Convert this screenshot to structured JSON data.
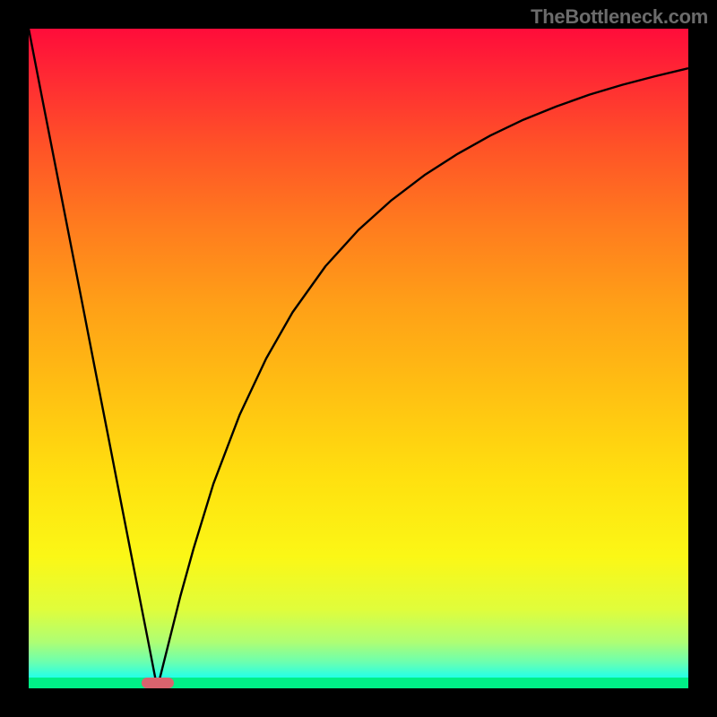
{
  "watermark": "TheBottleneck.com",
  "chart_data": {
    "type": "line",
    "title": "",
    "xlabel": "",
    "ylabel": "",
    "xlim": [
      0,
      100
    ],
    "ylim": [
      0,
      100
    ],
    "x": [
      0,
      2,
      4,
      6,
      8,
      10,
      12,
      14,
      16,
      18,
      19.5,
      21,
      23,
      25,
      28,
      32,
      36,
      40,
      45,
      50,
      55,
      60,
      65,
      70,
      75,
      80,
      85,
      90,
      95,
      100
    ],
    "values": [
      100,
      89.7,
      79.5,
      69.2,
      59.0,
      48.7,
      38.5,
      28.2,
      17.9,
      7.7,
      0,
      6.0,
      14.0,
      21.2,
      31.0,
      41.5,
      50.0,
      57.0,
      64.0,
      69.5,
      74.0,
      77.8,
      81.0,
      83.8,
      86.2,
      88.2,
      90.0,
      91.5,
      92.8,
      94.0
    ],
    "optimum_x": 19.5,
    "optimum_marker_width_pct": 4.9,
    "background_gradient": [
      "#ff0c3a",
      "#ff5327",
      "#ffa017",
      "#ffe00f",
      "#aefe74",
      "#00ffff"
    ],
    "bottom_strip_color": "#00ef87",
    "marker_color": "#d9636e",
    "curve_color": "#000000"
  }
}
